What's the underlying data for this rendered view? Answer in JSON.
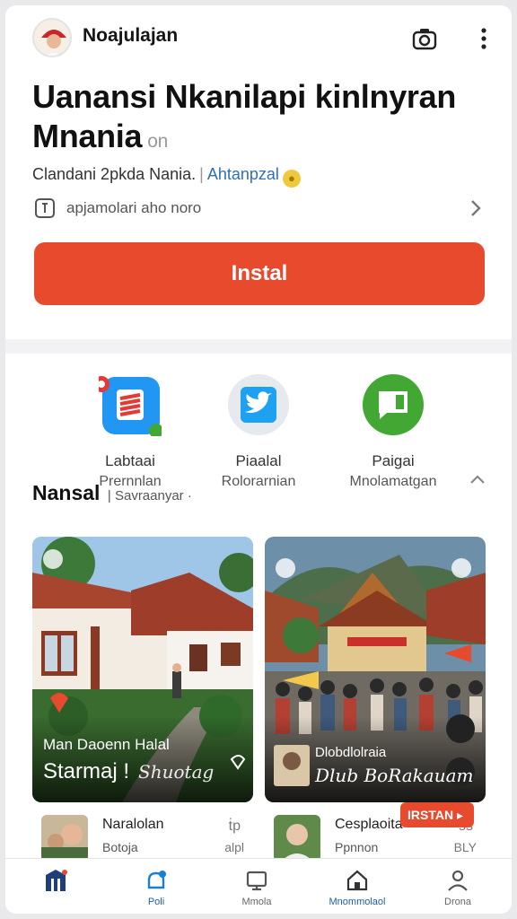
{
  "header": {
    "app_name": "Noajulajan",
    "icons": [
      "camera-icon",
      "more-vert-icon"
    ]
  },
  "app": {
    "title": "Uanansi Nkanilapi kinlnyran Mnania",
    "title_suffix": "on",
    "developer": "Clandani 2pkda Nania.",
    "category": "Ahtanpzal",
    "info_text": "apjamolari aho noro",
    "install_label": "Instal"
  },
  "share": [
    {
      "line1": "Labtaai",
      "line2": "Prernnlan",
      "icon": "red-app-icon",
      "color": "#2196f3"
    },
    {
      "line1": "Piaalal",
      "line2": "Rolorarnian",
      "icon": "twitter-icon",
      "color": "#1da1f2"
    },
    {
      "line1": "Paigai",
      "line2": "Mnolamatgan",
      "icon": "chat-icon",
      "color": "#43a833"
    }
  ],
  "section": {
    "title": "Nansal",
    "subtitle": "Savraanyar"
  },
  "cards": [
    {
      "cap1": "Man Daoenn Halal",
      "cap2": "Starmaj !",
      "cap2b": "Shuotag"
    },
    {
      "cap1": "Dlobdlolraia",
      "cap2": "Dlub BoRakauam"
    }
  ],
  "list": [
    {
      "name": "Naralolan",
      "sub": "Botoja",
      "a": "ṫp",
      "b": "alpl"
    },
    {
      "name": "Cesplaoita",
      "sub": "Ppnnon",
      "a": "ss",
      "b": "BLY"
    }
  ],
  "red_tag": "IRSTAN",
  "nav": [
    {
      "label": "",
      "icon": "home-logo-icon"
    },
    {
      "label": "Poli",
      "icon": "bell-icon"
    },
    {
      "label": "Mmola",
      "icon": "screen-icon"
    },
    {
      "label": "Mnommolaol",
      "icon": "house-icon"
    },
    {
      "label": "Drona",
      "icon": "person-icon"
    }
  ],
  "colors": {
    "accent": "#e84a2e",
    "link": "#2f6fb8",
    "active_nav": "#1b5fa8"
  }
}
